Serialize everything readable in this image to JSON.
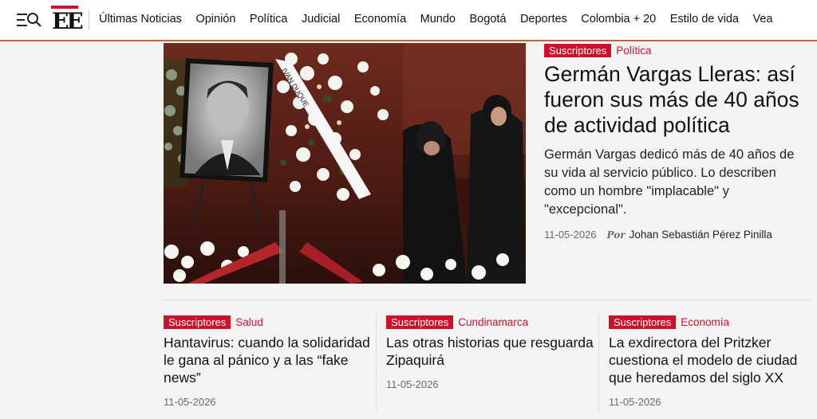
{
  "header": {
    "logo_text": "EE",
    "nav": [
      "Últimas Noticias",
      "Opinión",
      "Política",
      "Judicial",
      "Economía",
      "Mundo",
      "Bogotá",
      "Deportes",
      "Colombia + 20",
      "Estilo de vida",
      "Vea"
    ]
  },
  "hero": {
    "tag": "Suscriptores",
    "section": "Política",
    "title": "Germán Vargas Lleras: así fueron sus más de 40 años de actividad política",
    "summary": "Germán Vargas dedicó más de 40 años de su vida al servicio público. Lo describen como un hombre \"implacable\" y \"excepcional\".",
    "date": "11-05-2026",
    "by": "Por",
    "author": "Johan Sebastián Pérez Pinilla",
    "ribbon_text": "IVAN DUQUE"
  },
  "cards": [
    {
      "tag": "Suscriptores",
      "section": "Salud",
      "title": "Hantavirus: cuando la solidaridad le gana al pánico y a las “fake news”",
      "date": "11-05-2026"
    },
    {
      "tag": "Suscriptores",
      "section": "Cundinamarca",
      "title": "Las otras historias que resguarda Zipaquirá",
      "date": "11-05-2026"
    },
    {
      "tag": "Suscriptores",
      "section": "Economía",
      "title": "La exdirectora del Pritzker cuestiona el modelo de ciudad que heredamos del siglo XX",
      "date": "11-05-2026"
    }
  ],
  "colors": {
    "accent": "#d0102b",
    "header_border": "#c7623a"
  }
}
